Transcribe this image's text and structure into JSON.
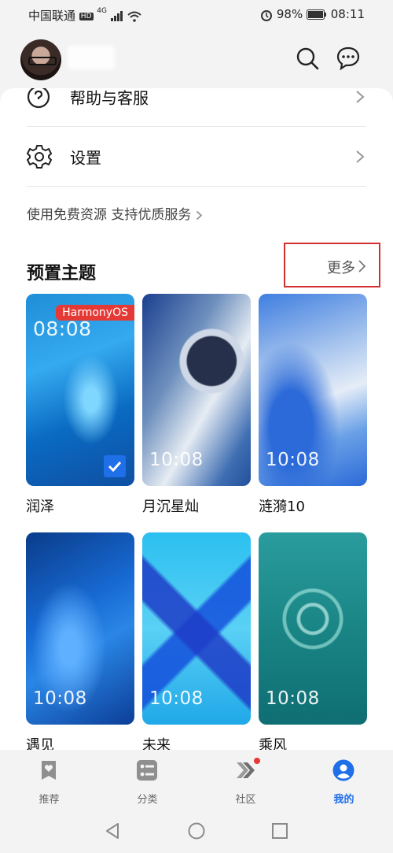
{
  "status_bar": {
    "carrier": "中国联通",
    "network_badge": "HD",
    "network_type": "4G",
    "battery": "98%",
    "time": "08:11"
  },
  "header": {
    "icons": [
      "search-icon",
      "message-icon"
    ]
  },
  "menu": [
    {
      "label": "帮助与客服",
      "icon": "help-icon"
    },
    {
      "label": "设置",
      "icon": "gear-icon"
    }
  ],
  "promo_text": "使用免费资源 支持优质服务",
  "themes_section": {
    "title": "预置主题",
    "more_label": "更多",
    "highlight_color": "#d32f2f",
    "themes": [
      {
        "name": "润泽",
        "time": "08:08",
        "badge": "HarmonyOS",
        "selected": true
      },
      {
        "name": "月沉星灿",
        "time": "10:08"
      },
      {
        "name": "涟漪10",
        "time": "10:08"
      },
      {
        "name": "遇见",
        "time": "10:08"
      },
      {
        "name": "未来",
        "time": "10:08"
      },
      {
        "name": "乘风",
        "time": "10:08"
      }
    ]
  },
  "bottom_nav": {
    "active_color": "#1e6fe8",
    "items": [
      {
        "label": "推荐",
        "icon": "recommend-icon"
      },
      {
        "label": "分类",
        "icon": "category-icon"
      },
      {
        "label": "社区",
        "icon": "community-icon",
        "has_dot": true
      },
      {
        "label": "我的",
        "icon": "profile-icon",
        "active": true
      }
    ]
  }
}
